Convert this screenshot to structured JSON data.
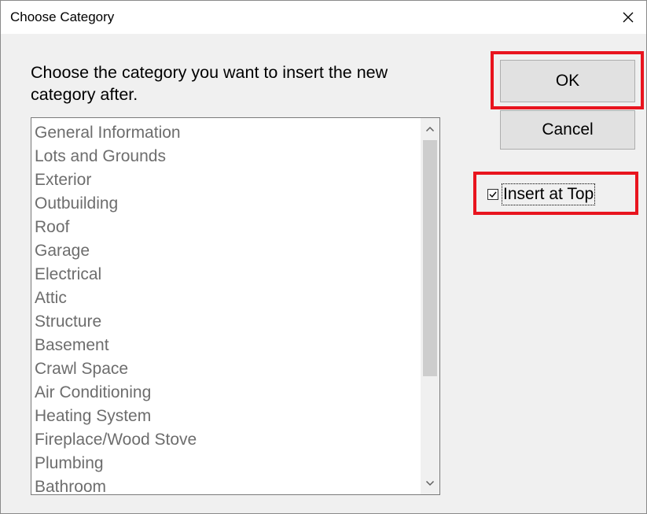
{
  "window": {
    "title": "Choose Category",
    "close_glyph": "close-icon"
  },
  "prompt": "Choose the category you want to insert the new category after.",
  "categories": [
    "General Information",
    "Lots and Grounds",
    "Exterior",
    "Outbuilding",
    "Roof",
    "Garage",
    "Electrical",
    "Attic",
    "Structure",
    "Basement",
    "Crawl Space",
    "Air Conditioning",
    "Heating System",
    "Fireplace/Wood Stove",
    "Plumbing",
    "Bathroom"
  ],
  "buttons": {
    "ok_label": "OK",
    "cancel_label": "Cancel"
  },
  "insert_at_top": {
    "label": "Insert at Top",
    "checked": true
  },
  "colors": {
    "highlight": "#e8141e",
    "list_text": "#6d6d6d",
    "dialog_bg": "#f0f0f0"
  }
}
